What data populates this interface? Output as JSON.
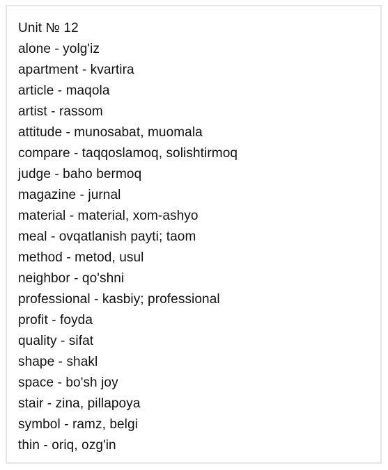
{
  "title": "Unit № 12",
  "entries": [
    "alone - yolg'iz",
    "apartment - kvartira",
    "article - maqola",
    "artist - rassom",
    "attitude - munosabat, muomala",
    "compare - taqqoslamoq, solishtirmoq",
    "judge - baho bermoq",
    "magazine - jurnal",
    "material - material, xom-ashyo",
    "meal - ovqatlanish payti; taom",
    "method - metod, usul",
    "neighbor - qo'shni",
    "professional - kasbiy; professional",
    "profit - foyda",
    "quality - sifat",
    "shape - shakl",
    "space - bo'sh joy",
    "stair - zina, pillapoya",
    "symbol - ramz, belgi",
    "thin - oriq, ozg'in"
  ],
  "colors": {
    "text": "#111111",
    "border": "#e6e6e6",
    "background": "#ffffff"
  }
}
